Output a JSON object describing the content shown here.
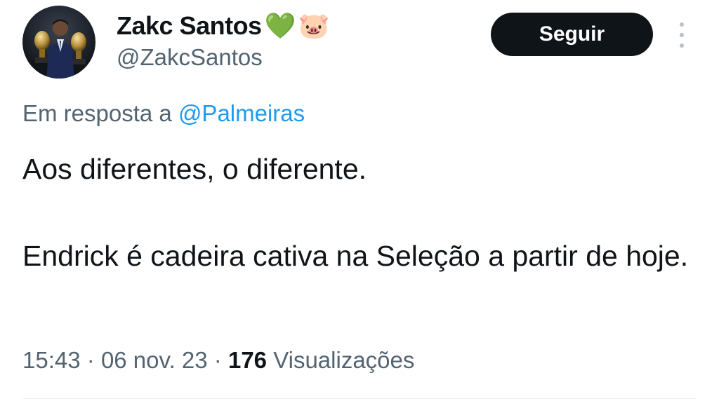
{
  "author": {
    "display_name": "Zakc Santos",
    "emoji_badges": [
      "💚",
      "🐷"
    ],
    "handle": "@ZakcSantos",
    "avatar_icon": "user-avatar-photo"
  },
  "actions": {
    "follow_label": "Seguir",
    "more_icon": "more-vertical-icon"
  },
  "reply": {
    "prefix": "Em resposta a",
    "mention": "@Palmeiras"
  },
  "tweet": {
    "paragraph_1": "Aos diferentes, o diferente.",
    "paragraph_2": "Endrick é cadeira cativa na Seleção a partir de hoje."
  },
  "meta": {
    "time": "15:43",
    "separator": "·",
    "date": "06 nov. 23",
    "views_count": "176",
    "views_label": "Visualizações"
  },
  "colors": {
    "text_primary": "#0f1419",
    "text_secondary": "#536471",
    "link": "#1d9bf0",
    "follow_bg": "#0f1419",
    "follow_text": "#ffffff"
  }
}
